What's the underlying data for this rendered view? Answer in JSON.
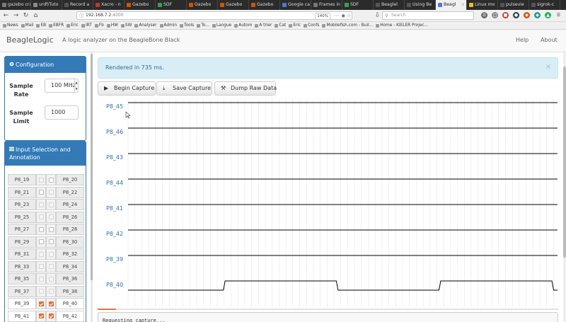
{
  "browser": {
    "tabs": [
      {
        "label": "gazebo cra",
        "color": "#7a7a7a"
      },
      {
        "label": "urdf/Tuto",
        "color": "#8a8a8a"
      },
      {
        "label": "Record a",
        "color": "#555555"
      },
      {
        "label": "Xacro - n",
        "color": "#c0392b"
      },
      {
        "label": "Gazebo",
        "color": "#d35400"
      },
      {
        "label": "SDF",
        "color": "#3aa04a"
      },
      {
        "label": "Gazebo",
        "color": "#d35400"
      },
      {
        "label": "Gazebo",
        "color": "#d35400"
      },
      {
        "label": "Gazebo",
        "color": "#d35400"
      },
      {
        "label": "Google ca",
        "color": "#4a7bd0"
      },
      {
        "label": "Frames in t",
        "color": "#777777"
      },
      {
        "label": "SDF",
        "color": "#3aa04a"
      },
      {
        "label": "Beaglel",
        "color": "#555555"
      },
      {
        "label": "Using Be",
        "color": "#555555"
      },
      {
        "label": "Beagl",
        "color": "#4a7bd0",
        "active": true
      },
      {
        "label": "Linux mo",
        "color": "#e8c21c"
      },
      {
        "label": "pulsevie",
        "color": "#555555"
      },
      {
        "label": "sigrok-c",
        "color": "#555555"
      }
    ],
    "url_host": "192.168.7.2",
    "url_port": ":4000",
    "zoom": "140%",
    "search_placeholder": "Search",
    "bookmarks": [
      "News",
      "Mail",
      "EB",
      "EBFR",
      "Eric",
      "IRT",
      "Fb",
      "HW",
      "SW",
      "Analyser",
      "Admin",
      "Tools",
      "To...",
      "Langue",
      "Autom",
      "A trier",
      "Cat",
      "Eric",
      "Confs",
      "Mobilefish.com - Buil...",
      "Home - KIELER Projec..."
    ]
  },
  "app": {
    "brand": "BeagleLogic",
    "tagline": "A logic analyzer on the BeagleBone Black",
    "nav_help": "Help",
    "nav_about": "About"
  },
  "config": {
    "title": "Configuration",
    "sample_rate_label": "Sample Rate",
    "sample_rate_value": "100 MHz",
    "sample_limit_label": "Sample Limit",
    "sample_limit_value": "1000"
  },
  "inputs": {
    "title": "Input Selection and Annotation",
    "rows": [
      {
        "left": "P8_19",
        "right": "P8_20",
        "left_enabled": false,
        "right_enabled": true,
        "left_checked": false,
        "right_checked": false
      },
      {
        "left": "P8_21",
        "right": "P8_22",
        "left_enabled": true,
        "right_enabled": false,
        "left_checked": false,
        "right_checked": false
      },
      {
        "left": "P8_23",
        "right": "P8_24",
        "left_enabled": false,
        "right_enabled": false,
        "left_checked": false,
        "right_checked": false
      },
      {
        "left": "P8_25",
        "right": "P8_26",
        "left_enabled": false,
        "right_enabled": false,
        "left_checked": false,
        "right_checked": false
      },
      {
        "left": "P8_27",
        "right": "P8_28",
        "left_enabled": true,
        "right_enabled": true,
        "left_checked": false,
        "right_checked": false
      },
      {
        "left": "P8_29",
        "right": "P8_30",
        "left_enabled": true,
        "right_enabled": true,
        "left_checked": false,
        "right_checked": false
      },
      {
        "left": "P8_31",
        "right": "P8_32",
        "left_enabled": false,
        "right_enabled": false,
        "left_checked": false,
        "right_checked": false
      },
      {
        "left": "P8_33",
        "right": "P8_34",
        "left_enabled": false,
        "right_enabled": false,
        "left_checked": false,
        "right_checked": false
      },
      {
        "left": "P8_35",
        "right": "P8_36",
        "left_enabled": false,
        "right_enabled": false,
        "left_checked": false,
        "right_checked": false
      },
      {
        "left": "P8_37",
        "right": "P8_38",
        "left_enabled": false,
        "right_enabled": false,
        "left_checked": false,
        "right_checked": false
      },
      {
        "left": "P8_39",
        "right": "P8_40",
        "left_enabled": true,
        "right_enabled": true,
        "left_checked": true,
        "right_checked": true
      },
      {
        "left": "P8_41",
        "right": "P8_42",
        "left_enabled": true,
        "right_enabled": true,
        "left_checked": true,
        "right_checked": true
      }
    ]
  },
  "main": {
    "alert_text": "Rendered in 735 ms.",
    "alert_close": "×",
    "begin_capture": "Begin Capture",
    "save_capture": "Save Capture",
    "dump_raw": "Dump Raw Data",
    "log_text": "Requesting capture...",
    "capture_progress": 0.04
  },
  "chart_data": {
    "type": "line",
    "x_range": [
      0,
      1000
    ],
    "grid": true,
    "series": [
      {
        "name": "P8_45",
        "x": [
          0,
          1000
        ],
        "y": [
          1,
          1
        ]
      },
      {
        "name": "P8_46",
        "x": [
          0,
          1000
        ],
        "y": [
          1,
          1
        ]
      },
      {
        "name": "P8_43",
        "x": [
          0,
          1000
        ],
        "y": [
          1,
          1
        ]
      },
      {
        "name": "P8_44",
        "x": [
          0,
          1000
        ],
        "y": [
          1,
          1
        ]
      },
      {
        "name": "P8_41",
        "x": [
          0,
          1000
        ],
        "y": [
          1,
          1
        ]
      },
      {
        "name": "P8_42",
        "x": [
          0,
          1000
        ],
        "y": [
          1,
          1
        ]
      },
      {
        "name": "P8_39",
        "x": [
          0,
          1000
        ],
        "y": [
          1,
          1
        ]
      },
      {
        "name": "P8_40",
        "x": [
          0,
          222,
          226,
          485,
          489,
          724,
          728,
          987,
          991,
          1000
        ],
        "y": [
          0,
          0,
          1,
          1,
          0,
          0,
          1,
          1,
          0,
          0
        ]
      }
    ],
    "colors": {
      "signal": "#000000",
      "label": "#2a6fb5",
      "grid": "#e6e6e6"
    }
  }
}
